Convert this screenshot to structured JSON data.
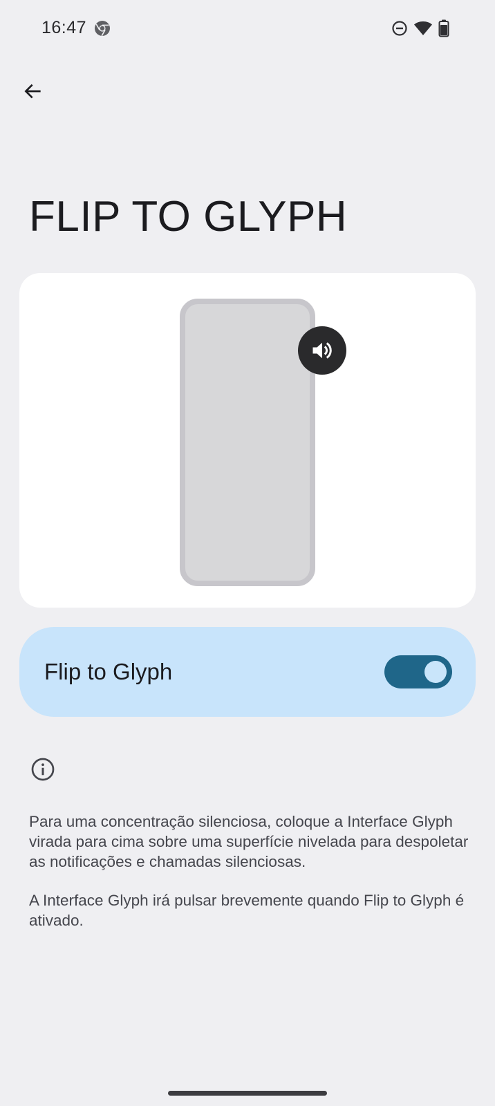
{
  "status_bar": {
    "time": "16:47",
    "icons": [
      "chrome-icon",
      "do-not-disturb-icon",
      "wifi-icon",
      "battery-icon"
    ]
  },
  "header": {
    "back_icon": "arrow-left-icon",
    "title": "FLIP TO GLYPH"
  },
  "illustration": {
    "phone": "phone-back-outline",
    "badge_icon": "volume-up-icon"
  },
  "toggle": {
    "label": "Flip to Glyph",
    "checked": true,
    "accent_color": "#1f6689",
    "card_color": "#c8e4fb"
  },
  "info": {
    "icon": "info-icon",
    "paragraph1": "Para uma concentração silenciosa, coloque a Interface Glyph virada para cima sobre uma superfície nivelada para despoletar as notificações e chamadas silenciosas.",
    "paragraph2": "A Interface Glyph irá pulsar brevemente quando Flip to Glyph é ativado."
  },
  "colors": {
    "background": "#efeff2",
    "card": "#ffffff"
  }
}
